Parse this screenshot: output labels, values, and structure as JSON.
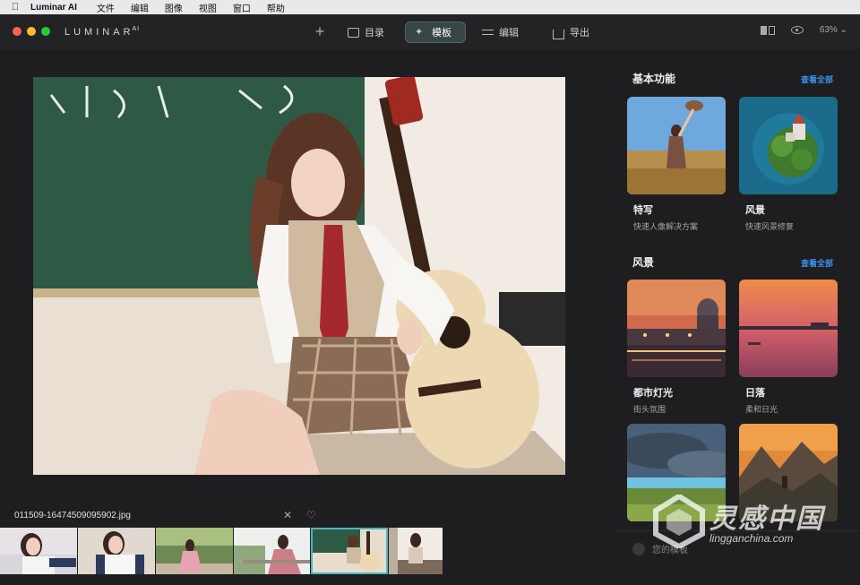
{
  "menubar": {
    "app_name": "Luminar AI",
    "items": [
      "文件",
      "编辑",
      "图像",
      "视图",
      "窗口",
      "帮助"
    ]
  },
  "toolbar": {
    "brand": "LUMINAR",
    "brand_sup": "AI",
    "add_label": "+",
    "nav": [
      {
        "label": "目录",
        "icon": "folder-icon"
      },
      {
        "label": "模板",
        "icon": "magic-wand-icon",
        "active": true
      },
      {
        "label": "编辑",
        "icon": "sliders-icon"
      },
      {
        "label": "导出",
        "icon": "export-icon"
      }
    ],
    "zoom": "63%"
  },
  "image": {
    "filename": "011509-16474509095902.jpg",
    "close_glyph": "✕",
    "favorite_glyph": "♡"
  },
  "filmstrip": {
    "count": 6,
    "selected_index": 4
  },
  "panel": {
    "sections": [
      {
        "title": "基本功能",
        "see_all": "查看全部",
        "cards": [
          {
            "title": "特写",
            "subtitle": "快速人像解决方案"
          },
          {
            "title": "风景",
            "subtitle": "快速风景修复"
          }
        ]
      },
      {
        "title": "风景",
        "see_all": "查看全部",
        "cards": [
          {
            "title": "都市灯光",
            "subtitle": "街头氛围"
          },
          {
            "title": "日落",
            "subtitle": "柔和日光"
          },
          {
            "title": "",
            "subtitle": ""
          },
          {
            "title": "",
            "subtitle": ""
          }
        ]
      }
    ],
    "your_presets": "您的模板"
  },
  "watermark": {
    "main": "灵感中国",
    "sub": "lingganchina.com"
  },
  "colors": {
    "background": "#1e1e20",
    "accent_teal": "#49b8c0",
    "link_blue": "#3a95f0"
  }
}
